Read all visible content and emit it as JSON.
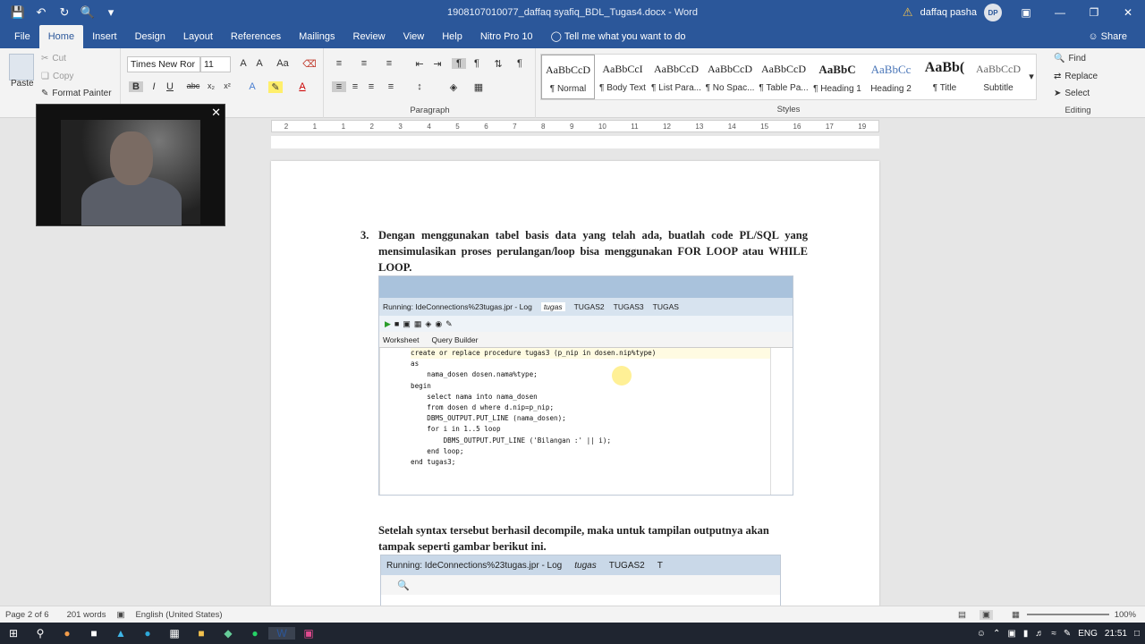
{
  "window": {
    "doc_title": "1908107010077_daffaq syafiq_BDL_Tugas4.docx - Word",
    "user_name": "daffaq pasha",
    "user_initials": "DP"
  },
  "tabs": [
    "File",
    "Home",
    "Insert",
    "Design",
    "Layout",
    "References",
    "Mailings",
    "Review",
    "View",
    "Help",
    "Nitro Pro 10",
    "Tell me what you want to do"
  ],
  "share_label": "Share",
  "clipboard": {
    "paste": "Paste",
    "cut": "Cut",
    "copy": "Copy",
    "format_painter": "Format Painter"
  },
  "font": {
    "family": "Times New Ror",
    "size": "11"
  },
  "groups": {
    "paragraph": "Paragraph",
    "styles": "Styles",
    "editing": "Editing"
  },
  "styles": [
    {
      "sample": "AaBbCcD",
      "name": "¶ Normal"
    },
    {
      "sample": "AaBbCcI",
      "name": "¶ Body Text"
    },
    {
      "sample": "AaBbCcD",
      "name": "¶ List Para..."
    },
    {
      "sample": "AaBbCcD",
      "name": "¶ No Spac..."
    },
    {
      "sample": "AaBbCcD",
      "name": "¶ Table Pa..."
    },
    {
      "sample": "AaBbC",
      "name": "¶ Heading 1"
    },
    {
      "sample": "AaBbCc",
      "name": "Heading 2"
    },
    {
      "sample": "AaBb(",
      "name": "¶ Title"
    },
    {
      "sample": "AaBbCcD",
      "name": "Subtitle"
    }
  ],
  "editing": {
    "find": "Find",
    "replace": "Replace",
    "select": "Select"
  },
  "document": {
    "q_number": "3.",
    "q_text": "Dengan menggunakan tabel basis data yang telah ada, buatlah code PL/SQL yang mensimulasikan proses perulangan/loop bisa menggunakan FOR LOOP atau WHILE LOOP.",
    "para2": "Setelah syntax tersebut berhasil decompile, maka untuk tampilan outputnya akan tampak seperti gambar berikut ini."
  },
  "ide": {
    "tabs": [
      "Running: IdeConnections%23tugas.jpr - Log",
      "tugas",
      "TUGAS2",
      "TUGAS3",
      "TUGAS"
    ],
    "subtabs": [
      "Worksheet",
      "Query Builder"
    ],
    "code": [
      "create or replace procedure tugas3 (p_nip in dosen.nip%type)",
      "as",
      "    nama_dosen dosen.nama%type;",
      "begin",
      "    select nama into nama_dosen",
      "    from dosen d where d.nip=p_nip;",
      "    DBMS_OUTPUT.PUT_LINE (nama_dosen);",
      "    for i in 1..5 loop",
      "        DBMS_OUTPUT.PUT_LINE ('Bilangan :' || i);",
      "    end loop;",
      "end tugas3;"
    ],
    "tabs2": [
      "Running: IdeConnections%23tugas.jpr - Log",
      "tugas",
      "TUGAS2",
      "T"
    ]
  },
  "status": {
    "page": "Page 2 of 6",
    "words": "201 words",
    "language": "English (United States)",
    "zoom": "100%"
  },
  "tray": {
    "lang": "ENG",
    "time": "21:51"
  }
}
